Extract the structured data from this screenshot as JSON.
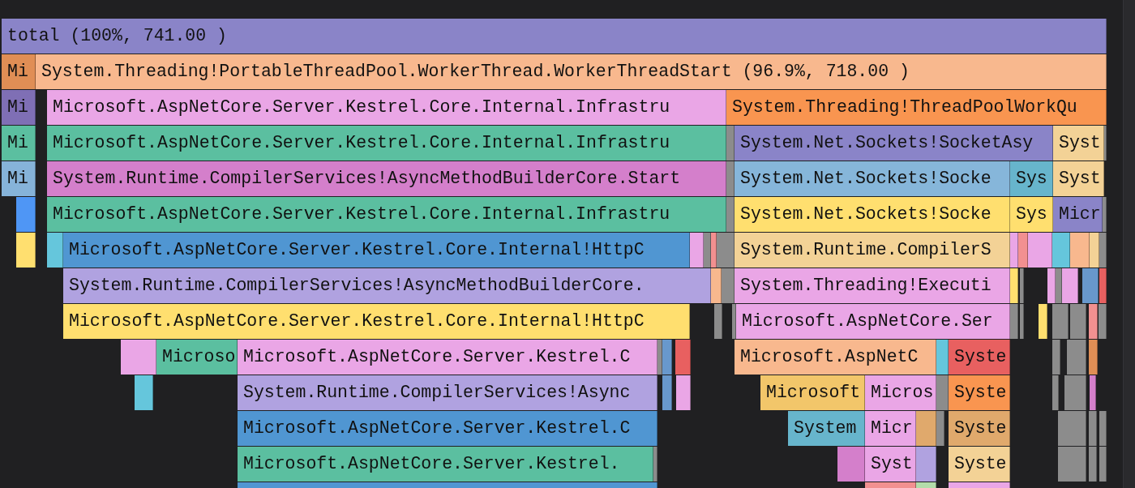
{
  "flame_graph": {
    "rows": [
      {
        "frames": [
          {
            "label": "total (100%, 741.00 )",
            "color": "#8a84c8"
          }
        ]
      },
      {
        "frames": [
          {
            "label": "Mi",
            "color": "#e08e55"
          },
          {
            "label": "System.Threading!PortableThreadPool.WorkerThread.WorkerThreadStart (96.9%, 718.00 )",
            "color": "#f8b88e"
          }
        ]
      },
      {
        "frames": [
          {
            "label": "Mi",
            "color": "#7f6fb5"
          },
          {
            "label": "Microsoft.AspNetCore.Server.Kestrel.Core.Internal.Infrastru",
            "color": "#eaa6e6"
          },
          {
            "label": "System.Threading!ThreadPoolWorkQu",
            "color": "#f99550"
          }
        ]
      },
      {
        "frames": [
          {
            "label": "Mi",
            "color": "#5bbfa0"
          },
          {
            "label": "Microsoft.AspNetCore.Server.Kestrel.Core.Internal.Infrastru",
            "color": "#5bbfa0"
          },
          {
            "color": "#8c8c8c"
          },
          {
            "label": "System.Net.Sockets!SocketAsy",
            "color": "#8a84c8"
          },
          {
            "label": "Syst",
            "color": "#f3d296"
          },
          {
            "color": "#8c8c8c"
          }
        ]
      },
      {
        "frames": [
          {
            "label": "Mi",
            "color": "#86b3d9"
          },
          {
            "label": "System.Runtime.CompilerServices!AsyncMethodBuilderCore.Start",
            "color": "#d47fcb"
          },
          {
            "color": "#8c8c8c"
          },
          {
            "label": "System.Net.Sockets!Socke",
            "color": "#86b6da"
          },
          {
            "label": "Sys",
            "color": "#67b5cc"
          },
          {
            "label": "Syst",
            "color": "#f3d296"
          }
        ]
      },
      {
        "frames": [
          {
            "color": "#4f96f5"
          },
          {
            "label": "Microsoft.AspNetCore.Server.Kestrel.Core.Internal.Infrastru",
            "color": "#5bbfa0"
          },
          {
            "color": "#8c8c8c"
          },
          {
            "label": "System.Net.Sockets!Socke",
            "color": "#ffdf6f"
          },
          {
            "label": "Sys",
            "color": "#ffdf6f"
          },
          {
            "label": "Micr",
            "color": "#8a84c8"
          },
          {
            "color": "#8c8c8c"
          }
        ]
      },
      {
        "frames": [
          {
            "color": "#ffdf6f"
          },
          {
            "color": "#65c6dc"
          },
          {
            "label": "Microsoft.AspNetCore.Server.Kestrel.Core.Internal!HttpC",
            "color": "#5096d2"
          },
          {
            "color": "#eaa6e6"
          },
          {
            "color": "#8c8c8c"
          },
          {
            "color": "#f29090"
          },
          {
            "color": "#8c8c8c"
          },
          {
            "label": "System.Runtime.CompilerS",
            "color": "#f3d296"
          },
          {
            "color": "#eaa6e6"
          },
          {
            "color": "#f29090"
          },
          {
            "color": "#eaa6e6"
          },
          {
            "color": "#65c6dc"
          },
          {
            "color": "#f8b88e"
          },
          {
            "color": "#f3d296"
          },
          {
            "color": "#8c8c8c"
          }
        ]
      },
      {
        "frames": [
          {
            "label": "System.Runtime.CompilerServices!AsyncMethodBuilderCore.",
            "color": "#b0a2e0"
          },
          {
            "color": "#f8b88e"
          },
          {
            "color": "#8c8c8c"
          },
          {
            "label": "System.Threading!Executi",
            "color": "#eaa6e6"
          },
          {
            "color": "#ffdf6f"
          },
          {
            "color": "#8c8c8c"
          },
          {
            "color": "#eaa6e6"
          },
          {
            "color": "#8c8c8c"
          },
          {
            "color": "#eaa6e6"
          },
          {
            "color": "#6898cc"
          },
          {
            "color": "#e86060"
          }
        ]
      },
      {
        "frames": [
          {
            "label": "Microsoft.AspNetCore.Server.Kestrel.Core.Internal!HttpC",
            "color": "#ffdf6f"
          },
          {
            "color": "#8c8c8c"
          },
          {
            "color": "#8c8c8c"
          },
          {
            "label": "Microsoft.AspNetCore.Ser",
            "color": "#eaa6e6"
          },
          {
            "color": "#8c8c8c"
          },
          {
            "color": "#8c8c8c"
          },
          {
            "color": "#ffdf6f"
          },
          {
            "color": "#8c8c8c"
          },
          {
            "color": "#8c8c8c"
          },
          {
            "color": "#f29090"
          },
          {
            "color": "#8c8c8c"
          }
        ]
      },
      {
        "frames": [
          {
            "color": "#eaa6e6"
          },
          {
            "label": "Microso",
            "color": "#5bbfa0"
          },
          {
            "label": "Microsoft.AspNetCore.Server.Kestrel.C",
            "color": "#eaa6e6"
          },
          {
            "color": "#8c8c8c"
          },
          {
            "color": "#6898cc"
          },
          {
            "color": "#e86060"
          },
          {
            "label": "Microsoft.AspNetC",
            "color": "#f8b88e"
          },
          {
            "color": "#65c6dc"
          },
          {
            "label": "Syste",
            "color": "#e86060"
          },
          {
            "color": "#8c8c8c"
          },
          {
            "color": "#8c8c8c"
          },
          {
            "color": "#e08e55"
          }
        ]
      },
      {
        "frames": [
          {
            "color": "#65c6dc"
          },
          {
            "label": "System.Runtime.CompilerServices!Async",
            "color": "#b0a2e0"
          },
          {
            "color": "#6898cc"
          },
          {
            "color": "#eaa6e6"
          },
          {
            "label": "Microsoft",
            "color": "#f2c66a"
          },
          {
            "label": "Micros",
            "color": "#eaa6e6"
          },
          {
            "color": "#8c8c8c"
          },
          {
            "label": "Syste",
            "color": "#f99550"
          },
          {
            "color": "#8c8c8c"
          },
          {
            "color": "#8c8c8c"
          },
          {
            "color": "#d47fcb"
          }
        ]
      },
      {
        "frames": [
          {
            "label": "Microsoft.AspNetCore.Server.Kestrel.C",
            "color": "#5096d2"
          },
          {
            "label": "System",
            "color": "#67b5cc"
          },
          {
            "label": "Micr",
            "color": "#eaa6e6"
          },
          {
            "color": "#e0a96c"
          },
          {
            "color": "#8c8c8c"
          },
          {
            "label": "Syste",
            "color": "#e0a96c"
          },
          {
            "color": "#8c8c8c"
          },
          {
            "color": "#8c8c8c"
          },
          {
            "color": "#8c8c8c"
          }
        ]
      },
      {
        "frames": [
          {
            "label": "Microsoft.AspNetCore.Server.Kestrel.",
            "color": "#5bbfa0"
          },
          {
            "color": "#8c8c8c"
          },
          {
            "color": "#d47fcb"
          },
          {
            "label": "Syst",
            "color": "#eaa6e6"
          },
          {
            "color": "#b0a2e0"
          },
          {
            "label": "Syste",
            "color": "#f3d296"
          },
          {
            "color": "#8c8c8c"
          },
          {
            "color": "#8c8c8c"
          },
          {
            "color": "#8c8c8c"
          }
        ]
      },
      {
        "frames": [
          {
            "color": "#5096d2"
          },
          {
            "color": "#f29090"
          },
          {
            "color": "#b3dcaa"
          },
          {
            "color": "#eaa6e6"
          }
        ]
      }
    ]
  }
}
